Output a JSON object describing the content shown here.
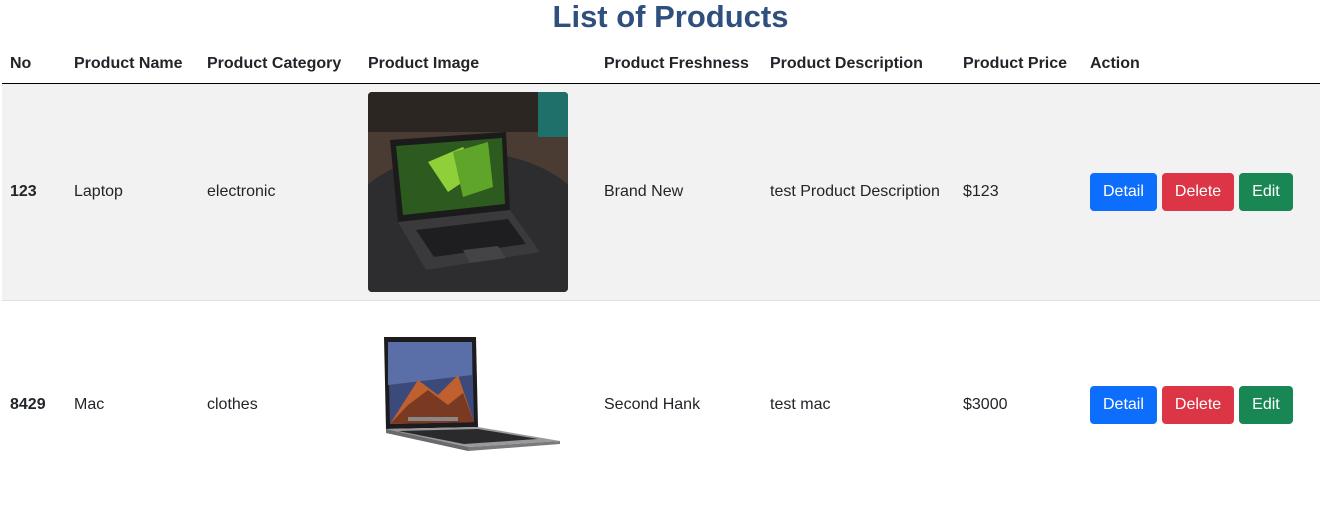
{
  "page_title": "List of Products",
  "headers": [
    "No",
    "Product Name",
    "Product Category",
    "Product Image",
    "Product Freshness",
    "Product Description",
    "Product Price",
    "Action"
  ],
  "rows": [
    {
      "no": "123",
      "name": "Laptop",
      "category": "electronic",
      "image": "laptop-photo",
      "freshness": "Brand New",
      "description": "test Product Description",
      "price": "$123"
    },
    {
      "no": "8429",
      "name": "Mac",
      "category": "clothes",
      "image": "macbook-photo",
      "freshness": "Second Hank",
      "description": "test mac",
      "price": "$3000"
    }
  ],
  "actions": {
    "detail": "Detail",
    "delete": "Delete",
    "edit": "Edit"
  },
  "colors": {
    "title": "#2f4f7f",
    "detail": "#0d6efd",
    "delete": "#dc3545",
    "edit": "#198754"
  }
}
